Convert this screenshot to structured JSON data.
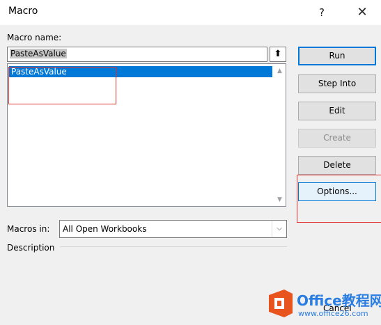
{
  "dialog": {
    "title": "Macro",
    "help_glyph": "?",
    "close_glyph": "✕"
  },
  "macro_name": {
    "label": "Macro name:",
    "value": "PasteAsValue"
  },
  "macro_list": {
    "items": [
      "PasteAsValue"
    ],
    "selected_index": 0
  },
  "buttons": {
    "run": "Run",
    "step_into": "Step Into",
    "edit": "Edit",
    "create": "Create",
    "delete": "Delete",
    "options": "Options...",
    "cancel": "Cancel"
  },
  "macros_in": {
    "label": "Macros in:",
    "value": "All Open Workbooks"
  },
  "description": {
    "label": "Description"
  },
  "watermark": {
    "title": "Office教程网",
    "url": "www.office26.com"
  },
  "colors": {
    "selection": "#0078d7",
    "annotation_red": "#e03030",
    "watermark_orange": "#e8541e",
    "watermark_blue": "#2a7de1"
  }
}
